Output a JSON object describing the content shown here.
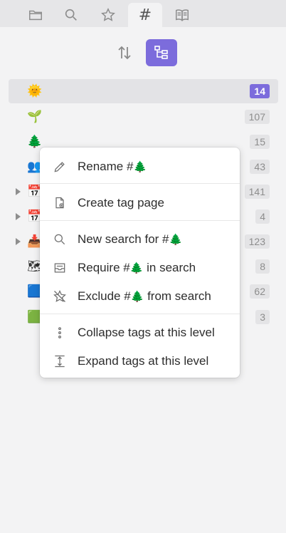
{
  "tabs": [
    {
      "name": "files",
      "icon": "folder-icon"
    },
    {
      "name": "search",
      "icon": "search-icon"
    },
    {
      "name": "bookmarks",
      "icon": "star-icon"
    },
    {
      "name": "tags",
      "icon": "hash-icon",
      "glyph": "#",
      "active": true
    },
    {
      "name": "reader",
      "icon": "book-icon"
    }
  ],
  "toolbar": {
    "sort_icon": "sort-arrows-icon",
    "tree_icon": "tree-view-icon",
    "tree_active": true,
    "accent": "#7c6cdc"
  },
  "tags": [
    {
      "emoji": "🌞",
      "count": "14",
      "selected": true,
      "expandable": false
    },
    {
      "emoji": "🌱",
      "count": "107",
      "expandable": false
    },
    {
      "emoji": "🌲",
      "count": "15",
      "expandable": false
    },
    {
      "emoji": "👥",
      "count": "43",
      "expandable": false
    },
    {
      "emoji": "📅",
      "count": "141",
      "expandable": true
    },
    {
      "emoji": "📅",
      "count": "4",
      "expandable": true
    },
    {
      "emoji": "📥",
      "count": "123",
      "expandable": true
    },
    {
      "emoji": "🗺",
      "count": "8",
      "expandable": false
    },
    {
      "emoji": "🟦",
      "count": "62",
      "expandable": false
    },
    {
      "emoji": "🟩",
      "count": "3",
      "expandable": false
    }
  ],
  "menu": {
    "rename": {
      "pre": "Rename #",
      "emoji": "🌲",
      "post": ""
    },
    "create_page": "Create tag page",
    "new_search": {
      "pre": "New search for #",
      "emoji": "🌲",
      "post": ""
    },
    "require": {
      "pre": "Require #",
      "emoji": "🌲",
      "post": " in search"
    },
    "exclude": {
      "pre": "Exclude #",
      "emoji": "🌲",
      "post": " from search"
    },
    "collapse": "Collapse tags at this level",
    "expand": "Expand tags at this level"
  }
}
